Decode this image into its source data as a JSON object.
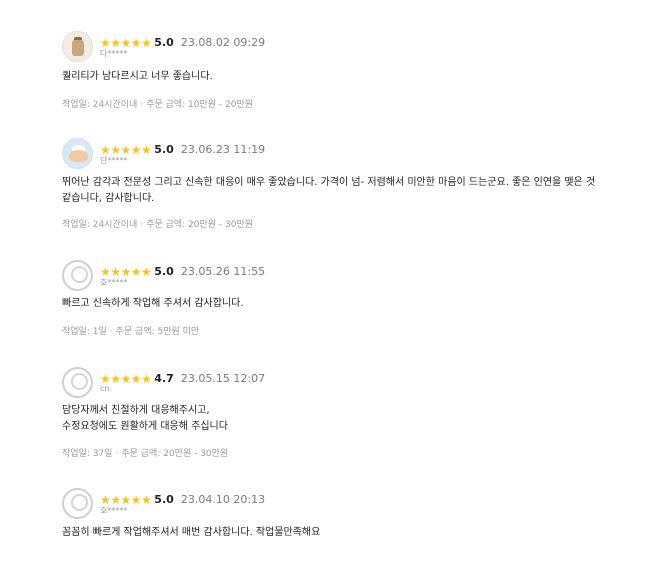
{
  "reviews": [
    {
      "avatar": "photo-product-avatar",
      "stars": "★★★★★",
      "score": "5.0",
      "date": "23.08.02 09:29",
      "user": "다*****",
      "content": [
        "퀄리티가 남다르시고 너무 좋습니다."
      ],
      "work_period": "작업일: 24시간이내",
      "order_amount": "주문 금액: 10만원 - 20만원"
    },
    {
      "avatar": "photo-character-avatar",
      "stars": "★★★★★",
      "score": "5.0",
      "date": "23.06.23 11:19",
      "user": "단*****",
      "content": [
        "뛰어난 감각과 전문성 그리고 신속한 대응이 매우 좋았습니다. 가격이 넘- 저렴해서 미안한 마음이 드는군요. 좋은 인연을 맺은 것",
        "같습니다, 감사합니다."
      ],
      "work_period": "작업일: 24시간이내",
      "order_amount": "주문 금액: 20만원 - 30만원"
    },
    {
      "avatar": "default-avatar",
      "stars": "★★★★★",
      "score": "5.0",
      "date": "23.05.26 11:55",
      "user": "호*****",
      "content": [
        "빠르고 신속하게 작업해 주셔서 감사합니다."
      ],
      "work_period": "작업일: 1일",
      "order_amount": "주문 금액: 5만원 미만"
    },
    {
      "avatar": "default-avatar",
      "stars": "★★★★★",
      "score": "4.7",
      "date": "23.05.15 12:07",
      "user": "cn",
      "content": [
        "담당자께서 친절하게 대응해주시고,",
        "수정요청에도 원활하게 대응해 주십니다"
      ],
      "work_period": "작업일: 37일",
      "order_amount": "주문 금액: 20만원 - 30만원"
    },
    {
      "avatar": "default-avatar",
      "stars": "★★★★★",
      "score": "5.0",
      "date": "23.04.10 20:13",
      "user": "호*****",
      "content": [
        "꼼꼼히 빠르게 작업해주셔서 매번 감사합니다. 작업물만족해요"
      ],
      "work_period": "",
      "order_amount": ""
    }
  ],
  "meta_separator": "·",
  "colors": {
    "star": "#f5c518",
    "meta": "#9a9a9a",
    "date": "#7a7a7a"
  }
}
